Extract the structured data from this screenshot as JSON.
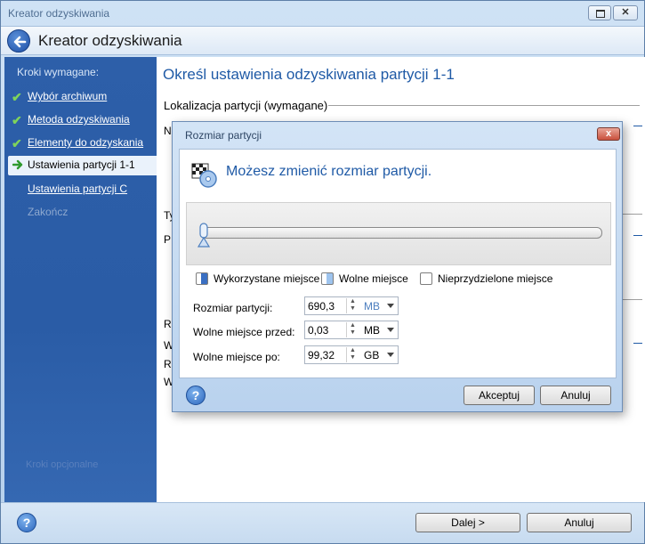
{
  "window": {
    "title": "Kreator odzyskiwania"
  },
  "header": {
    "title": "Kreator odzyskiwania"
  },
  "sidebar": {
    "required_label": "Kroki wymagane:",
    "items": [
      {
        "label": "Wybór archiwum",
        "state": "done"
      },
      {
        "label": "Metoda odzyskiwania",
        "state": "done"
      },
      {
        "label": "Elementy do odzyskania",
        "state": "done"
      },
      {
        "label": "Ustawienia partycji 1-1",
        "state": "active"
      },
      {
        "label": "Ustawienia partycji C",
        "state": "link"
      },
      {
        "label": "Zakończ",
        "state": "disabled"
      }
    ],
    "optional_label": "Kroki opcjonalne"
  },
  "main": {
    "title": "Określ ustawienia odzyskiwania partycji 1-1",
    "section_location": "Lokalizacja partycji (wymagane)",
    "fragments": {
      "n": "N",
      "ty": "Ty",
      "p": "P",
      "r": "R",
      "w": "W",
      "r2": "R",
      "w2": "W"
    }
  },
  "dialog": {
    "title": "Rozmiar partycji",
    "close_label": "x",
    "heading": "Możesz zmienić rozmiar partycji.",
    "legend": {
      "used": "Wykorzystane miejsce",
      "free": "Wolne miejsce",
      "unallocated": "Nieprzydzielone miejsce"
    },
    "fields": {
      "size_label": "Rozmiar partycji:",
      "size_value": "690,3",
      "size_unit": "MB",
      "free_before_label": "Wolne miejsce przed:",
      "free_before_value": "0,03",
      "free_before_unit": "MB",
      "free_after_label": "Wolne miejsce po:",
      "free_after_value": "99,32",
      "free_after_unit": "GB"
    },
    "slider_position": 0.0,
    "accept_label": "Akceptuj",
    "cancel_label": "Anuluj"
  },
  "footer": {
    "next_label": "Dalej >",
    "cancel_label": "Anuluj"
  },
  "colors": {
    "accent": "#1f5aa6",
    "sidebar": "#2d5fa9",
    "used_swatch": "#3a6fc2",
    "free_swatch": "#9ec4ee"
  }
}
